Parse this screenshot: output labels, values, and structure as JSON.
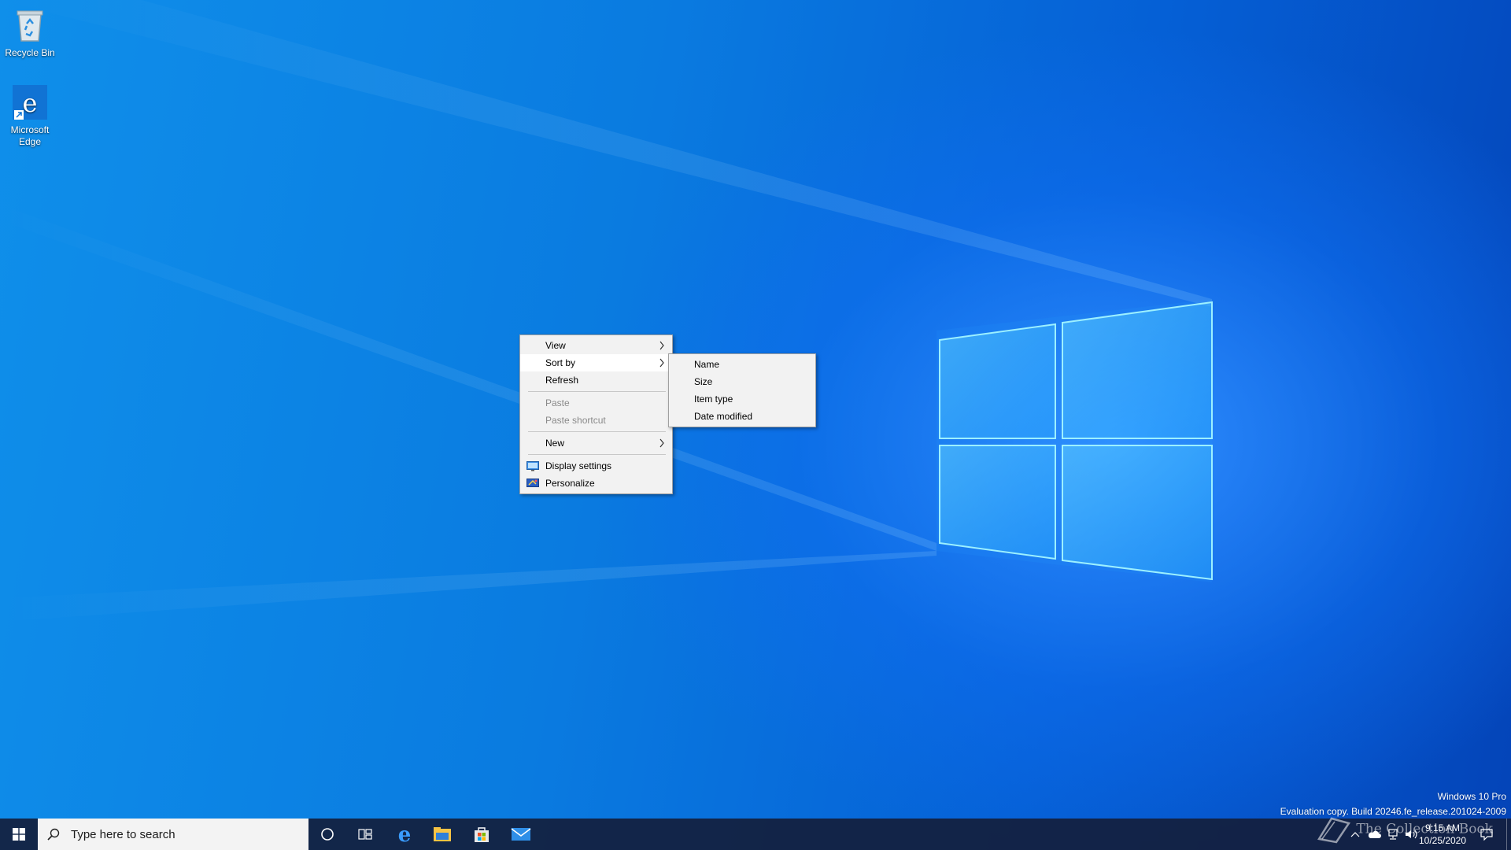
{
  "desktop": {
    "icons": [
      {
        "label": "Recycle Bin"
      },
      {
        "label": "Microsoft Edge"
      }
    ]
  },
  "context_menu": {
    "items": [
      {
        "label": "View",
        "submenu": true
      },
      {
        "label": "Sort by",
        "submenu": true,
        "highlighted": true
      },
      {
        "label": "Refresh"
      },
      {
        "label": "Paste",
        "disabled": true
      },
      {
        "label": "Paste shortcut",
        "disabled": true
      },
      {
        "label": "New",
        "submenu": true
      },
      {
        "label": "Display settings",
        "icon": "display-settings-icon"
      },
      {
        "label": "Personalize",
        "icon": "personalize-icon"
      }
    ]
  },
  "sort_submenu": {
    "items": [
      {
        "label": "Name"
      },
      {
        "label": "Size"
      },
      {
        "label": "Item type"
      },
      {
        "label": "Date modified"
      }
    ]
  },
  "watermark": {
    "line1": "Windows 10 Pro",
    "line2": "Evaluation copy. Build 20246.fe_release.201024-2009"
  },
  "taskbar": {
    "search_placeholder": "Type here to search",
    "pinned": [
      "start-icon",
      "cortana-icon",
      "task-view-icon",
      "edge-icon",
      "file-explorer-icon",
      "store-icon",
      "mail-icon"
    ],
    "clock_time": "9:15 AM",
    "clock_date": "10/25/2020",
    "brand_overlay": "The Collection Book"
  },
  "colors": {
    "desktop_blue": "#0a7be0",
    "taskbar": "#141e3c",
    "menu_bg": "#f2f2f2"
  }
}
